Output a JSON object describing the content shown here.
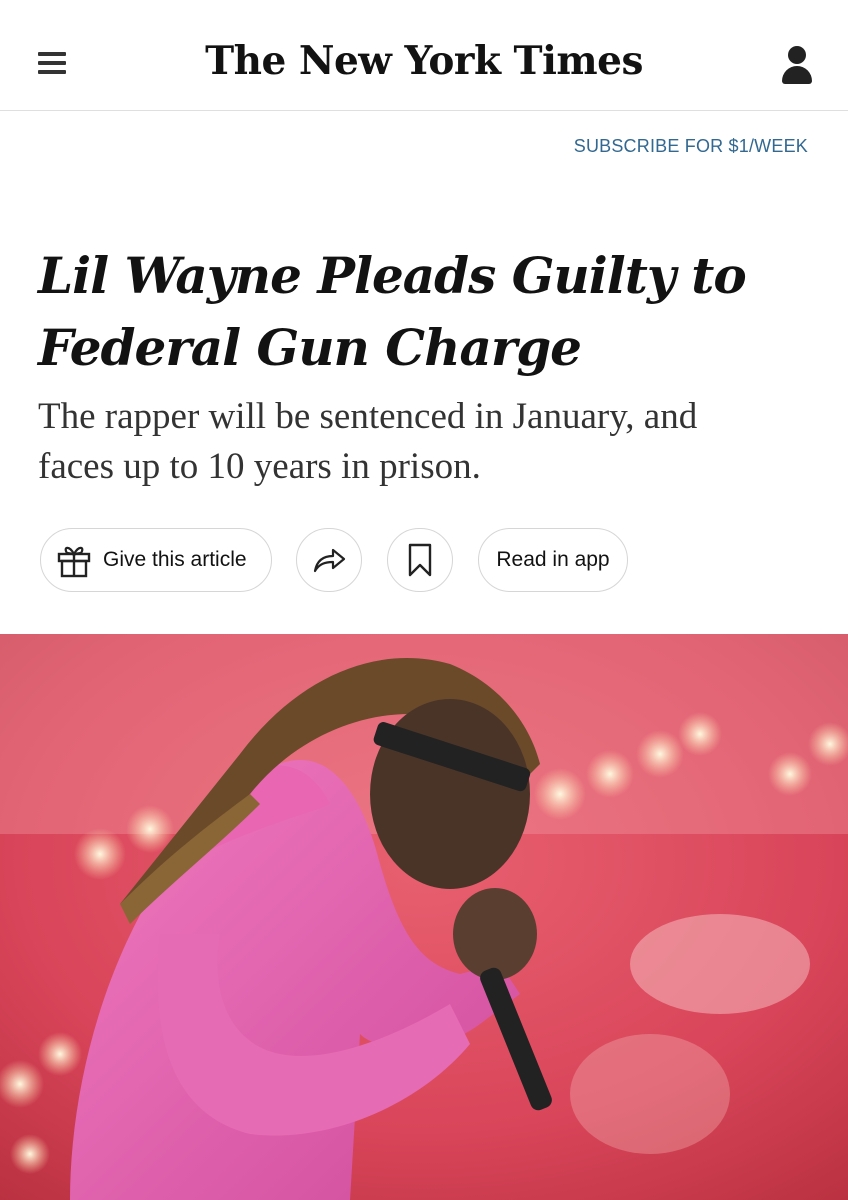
{
  "header": {
    "masthead": "The New York Times",
    "menu_icon": "hamburger-menu-icon",
    "account_icon": "user-account-icon"
  },
  "subscribe": {
    "label": "SUBSCRIBE FOR $1/WEEK",
    "color": "#326891"
  },
  "article": {
    "headline_line1": "Lil Wayne Pleads Guilty to",
    "headline_line2": "Federal Gun Charge",
    "summary_line1": "The rapper will be sentenced in January, and",
    "summary_line2": "faces up to 10 years in prison."
  },
  "actions": {
    "gift_label": "Give this article",
    "gift_icon": "gift-icon",
    "share_icon": "share-arrow-icon",
    "save_icon": "bookmark-icon",
    "read_in_app_label": "Read in app"
  },
  "photo": {
    "description": "Performer in pink hoodie singing into microphone on stage with red and pink lights",
    "background_color": "#d94a5a"
  }
}
